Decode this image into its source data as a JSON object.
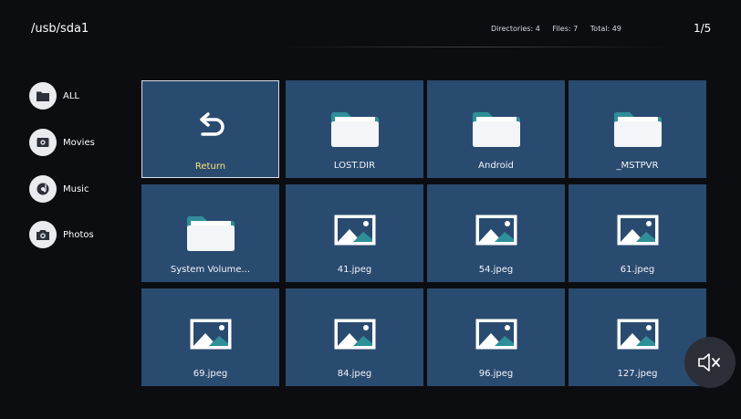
{
  "header": {
    "path": "/usb/sda1",
    "directories": "Directories: 4",
    "files": "Files: 7",
    "total": "Total: 49",
    "page": "1/5"
  },
  "sidebar": {
    "items": [
      {
        "label": "ALL",
        "icon": "folder-icon"
      },
      {
        "label": "Movies",
        "icon": "movie-icon"
      },
      {
        "label": "Music",
        "icon": "music-icon"
      },
      {
        "label": "Photos",
        "icon": "camera-icon"
      }
    ]
  },
  "grid": {
    "tiles": [
      {
        "label": "Return",
        "icon": "return-arrow-icon",
        "selected": true
      },
      {
        "label": "LOST.DIR",
        "icon": "folder-icon"
      },
      {
        "label": "Android",
        "icon": "folder-icon"
      },
      {
        "label": "_MSTPVR",
        "icon": "folder-icon"
      },
      {
        "label": "System Volume...",
        "icon": "folder-icon"
      },
      {
        "label": "41.jpeg",
        "icon": "image-file-icon"
      },
      {
        "label": "54.jpeg",
        "icon": "image-file-icon"
      },
      {
        "label": "61.jpeg",
        "icon": "image-file-icon"
      },
      {
        "label": "69.jpeg",
        "icon": "image-file-icon"
      },
      {
        "label": "84.jpeg",
        "icon": "image-file-icon"
      },
      {
        "label": "96.jpeg",
        "icon": "image-file-icon"
      },
      {
        "label": "127.jpeg",
        "icon": "image-file-icon"
      }
    ]
  },
  "controls": {
    "mute_icon": "speaker-muted-icon"
  },
  "colors": {
    "background": "#0c0d11",
    "tile": "#2a4b70",
    "selected_label": "#f5e37a",
    "icon_teal": "#2f8f98"
  }
}
